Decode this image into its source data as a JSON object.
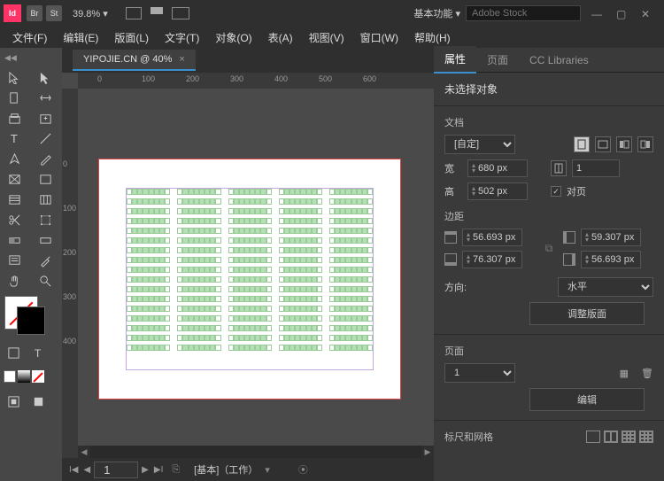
{
  "titlebar": {
    "id_logo": "Id",
    "br": "Br",
    "st": "St",
    "zoom": "39.8%",
    "workspace": "基本功能",
    "search_placeholder": "Adobe Stock"
  },
  "menu": {
    "file": "文件(F)",
    "edit": "编辑(E)",
    "layout": "版面(L)",
    "type": "文字(T)",
    "object": "对象(O)",
    "table": "表(A)",
    "view": "视图(V)",
    "window": "窗口(W)",
    "help": "帮助(H)"
  },
  "doctab": {
    "label": "YIPOJIE.CN @ 40%"
  },
  "ruler_h": {
    "t0": "0",
    "t100": "100",
    "t200": "200",
    "t300": "300",
    "t400": "400",
    "t500": "500",
    "t600": "600"
  },
  "ruler_v": {
    "t0": "0",
    "t100": "100",
    "t200": "200",
    "t300": "300",
    "t400": "400"
  },
  "status": {
    "page_current": "1",
    "profile": "[基本]（工作）"
  },
  "panel": {
    "tabs": {
      "props": "属性",
      "pages": "页面",
      "cc": "CC Libraries"
    },
    "no_selection": "未选择对象",
    "doc_section": "文档",
    "preset": "[自定]",
    "width_label": "宽",
    "width_value": "680 px",
    "height_label": "高",
    "height_value": "502 px",
    "binding_value": "1",
    "facing_pages": "对页",
    "margins_section": "边距",
    "margin_top": "56.693 px",
    "margin_bottom": "76.307 px",
    "margin_left": "59.307 px",
    "margin_right": "56.693 px",
    "orientation_label": "方向:",
    "orientation_value": "水平",
    "adjust_layout": "调整版面",
    "page_section": "页面",
    "page_value": "1",
    "edit_btn": "编辑",
    "rulers_section": "标尺和网格"
  }
}
